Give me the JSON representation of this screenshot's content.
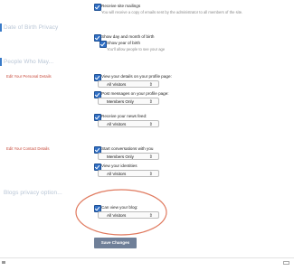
{
  "sections": {
    "dob_privacy": "Date of Birth Privacy",
    "people_who_may": "People Who May...",
    "blogs_privacy": "Blogs privacy option..."
  },
  "site_mailings": {
    "label": "Receive site mailings",
    "sub": "You will receive a copy of emails sent by the administrator to all members of the site."
  },
  "dob": {
    "show_day_month": "Show day and month of birth",
    "show_year": "Show year of birth",
    "show_year_sub": "You'll allow people to see your age"
  },
  "receive_details": {
    "row_label": "Edit Your Personal Details",
    "view_profile": {
      "label": "View your details on your profile page:",
      "value": "All Visitors"
    },
    "post_messages": {
      "label": "Post messages on your profile page:",
      "value": "Members Only"
    },
    "news_feed": {
      "label": "Receive your news feed:",
      "value": "All Visitors"
    }
  },
  "contact_details": {
    "row_label": "Edit Your Contact Details",
    "start_conversations": {
      "label": "Start conversations with you",
      "value": "Members Only"
    },
    "view_identities": {
      "label": "View your identities",
      "value": "All Visitors"
    }
  },
  "blog": {
    "can_view": {
      "label": "Can view your blog:",
      "value": "All Visitors"
    }
  },
  "save_button": "Save Changes",
  "accent_color": "#2f6fc6",
  "highlight_color": "#e07a5f"
}
